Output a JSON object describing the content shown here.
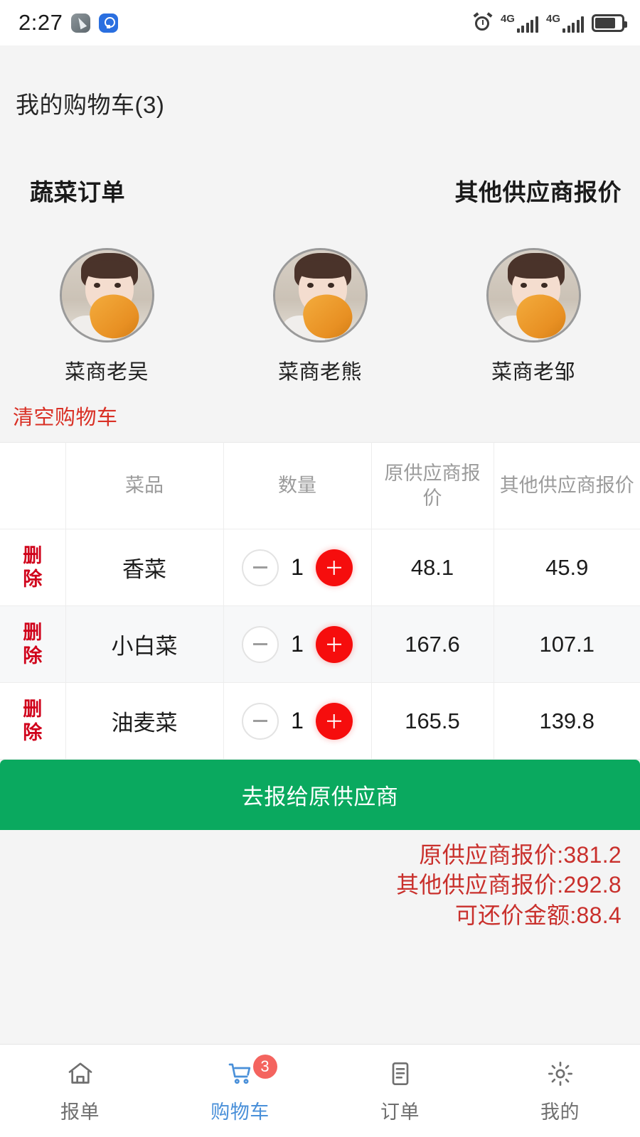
{
  "statusbar": {
    "time": "2:27",
    "icons_left": [
      "compass-app-icon",
      "lightbulb-app-icon"
    ],
    "icons_right": [
      "alarm-icon",
      "signal-4g-icon",
      "signal-4g-icon",
      "battery-icon"
    ],
    "network_label_1": "4G",
    "network_label_2": "4G"
  },
  "header": {
    "title": "我的购物车(3)"
  },
  "sections": {
    "left_heading": "蔬菜订单",
    "right_heading": "其他供应商报价"
  },
  "vendors": [
    {
      "name": "菜商老吴"
    },
    {
      "name": "菜商老熊"
    },
    {
      "name": "菜商老邹"
    }
  ],
  "actions": {
    "clear_cart": "清空购物车",
    "submit": "去报给原供应商"
  },
  "table": {
    "headers": [
      "",
      "菜品",
      "数量",
      "原供应商报价",
      "其他供应商报价"
    ],
    "rows": [
      {
        "delete_label": "删除",
        "name": "香菜",
        "qty": "1",
        "original_price": "48.1",
        "other_price": "45.9"
      },
      {
        "delete_label": "删除",
        "name": "小白菜",
        "qty": "1",
        "original_price": "167.6",
        "other_price": "107.1"
      },
      {
        "delete_label": "删除",
        "name": "油麦菜",
        "qty": "1",
        "original_price": "165.5",
        "other_price": "139.8"
      }
    ]
  },
  "summary": {
    "original_total": "原供应商报价:381.2",
    "other_total": "其他供应商报价:292.8",
    "savings": "可还价金额:88.4"
  },
  "tabbar": {
    "items": [
      {
        "label": "报单",
        "icon": "home-icon",
        "active": false,
        "badge": ""
      },
      {
        "label": "购物车",
        "icon": "cart-icon",
        "active": true,
        "badge": "3"
      },
      {
        "label": "订单",
        "icon": "document-icon",
        "active": false,
        "badge": ""
      },
      {
        "label": "我的",
        "icon": "gear-icon",
        "active": false,
        "badge": ""
      }
    ]
  },
  "colors": {
    "accent_red": "#d93025",
    "delete_red": "#d0021b",
    "plus_red": "#f60d0d",
    "submit_green": "#0aa95f",
    "summary_red": "#c9302c",
    "active_blue": "#4a90d9",
    "badge_red": "#f4645f",
    "page_bg": "#f4f4f4"
  }
}
